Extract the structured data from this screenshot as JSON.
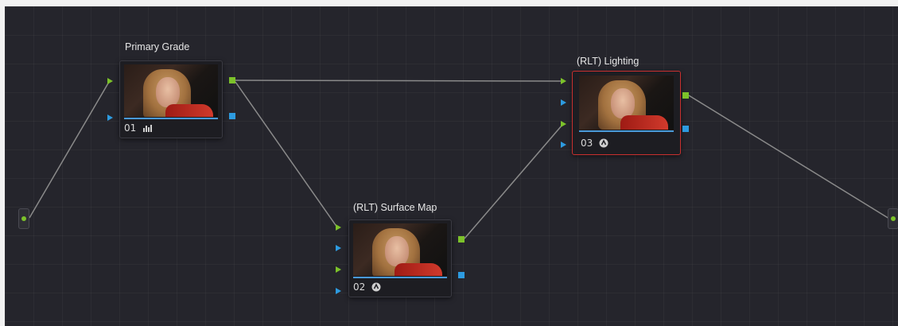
{
  "colors": {
    "canvas": "#25252c",
    "link": "#8a8a8a",
    "rgb_port": "#7cc22a",
    "key_port": "#2d9be0",
    "selected_border": "#c8302f"
  },
  "nodes": [
    {
      "label": "Primary Grade",
      "number": "01",
      "footer_icon": "histogram-icon",
      "selected": false
    },
    {
      "label": "(RLT) Surface Map",
      "number": "02",
      "footer_icon": "resolvefx-icon",
      "selected": false
    },
    {
      "label": "(RLT) Lighting",
      "number": "03",
      "footer_icon": "resolvefx-icon",
      "selected": true
    }
  ],
  "endpoints": {
    "source": "source-input-icon",
    "output": "output-icon"
  }
}
